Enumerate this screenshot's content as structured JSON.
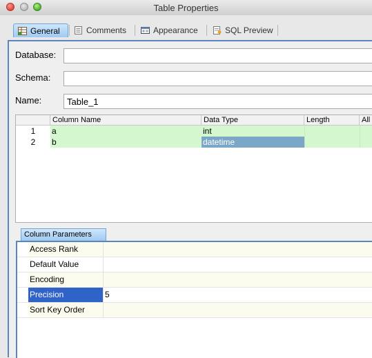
{
  "window": {
    "title": "Table Properties"
  },
  "tabs": [
    {
      "label": "General",
      "active": true,
      "icon": "table-grid-icon"
    },
    {
      "label": "Comments",
      "active": false,
      "icon": "notepad-icon"
    },
    {
      "label": "Appearance",
      "active": false,
      "icon": "window-icon"
    },
    {
      "label": "SQL Preview",
      "active": false,
      "icon": "sql-document-icon"
    }
  ],
  "form": {
    "database_label": "Database:",
    "database_value": "",
    "schema_label": "Schema:",
    "schema_value": "",
    "name_label": "Name:",
    "name_value": "Table_1"
  },
  "columns_grid": {
    "headers": [
      "Column Name",
      "Data Type",
      "Length",
      "All"
    ],
    "rows": [
      {
        "num": "1",
        "name": "a",
        "type": "int",
        "length": ""
      },
      {
        "num": "2",
        "name": "b",
        "type": "datetime",
        "length": ""
      }
    ]
  },
  "column_parameters": {
    "tab_label": "Column Parameters",
    "rows": [
      {
        "name": "Access Rank",
        "value": ""
      },
      {
        "name": "Default Value",
        "value": ""
      },
      {
        "name": "Encoding",
        "value": ""
      },
      {
        "name": "Precision",
        "value": "5",
        "selected": true
      },
      {
        "name": "Sort Key Order",
        "value": ""
      }
    ]
  },
  "colors": {
    "row_highlight": "#d4f7cf",
    "selected_cell": "#7aa7c7",
    "selection_blue": "#2f63c8",
    "panel_border": "#5b86bd"
  }
}
